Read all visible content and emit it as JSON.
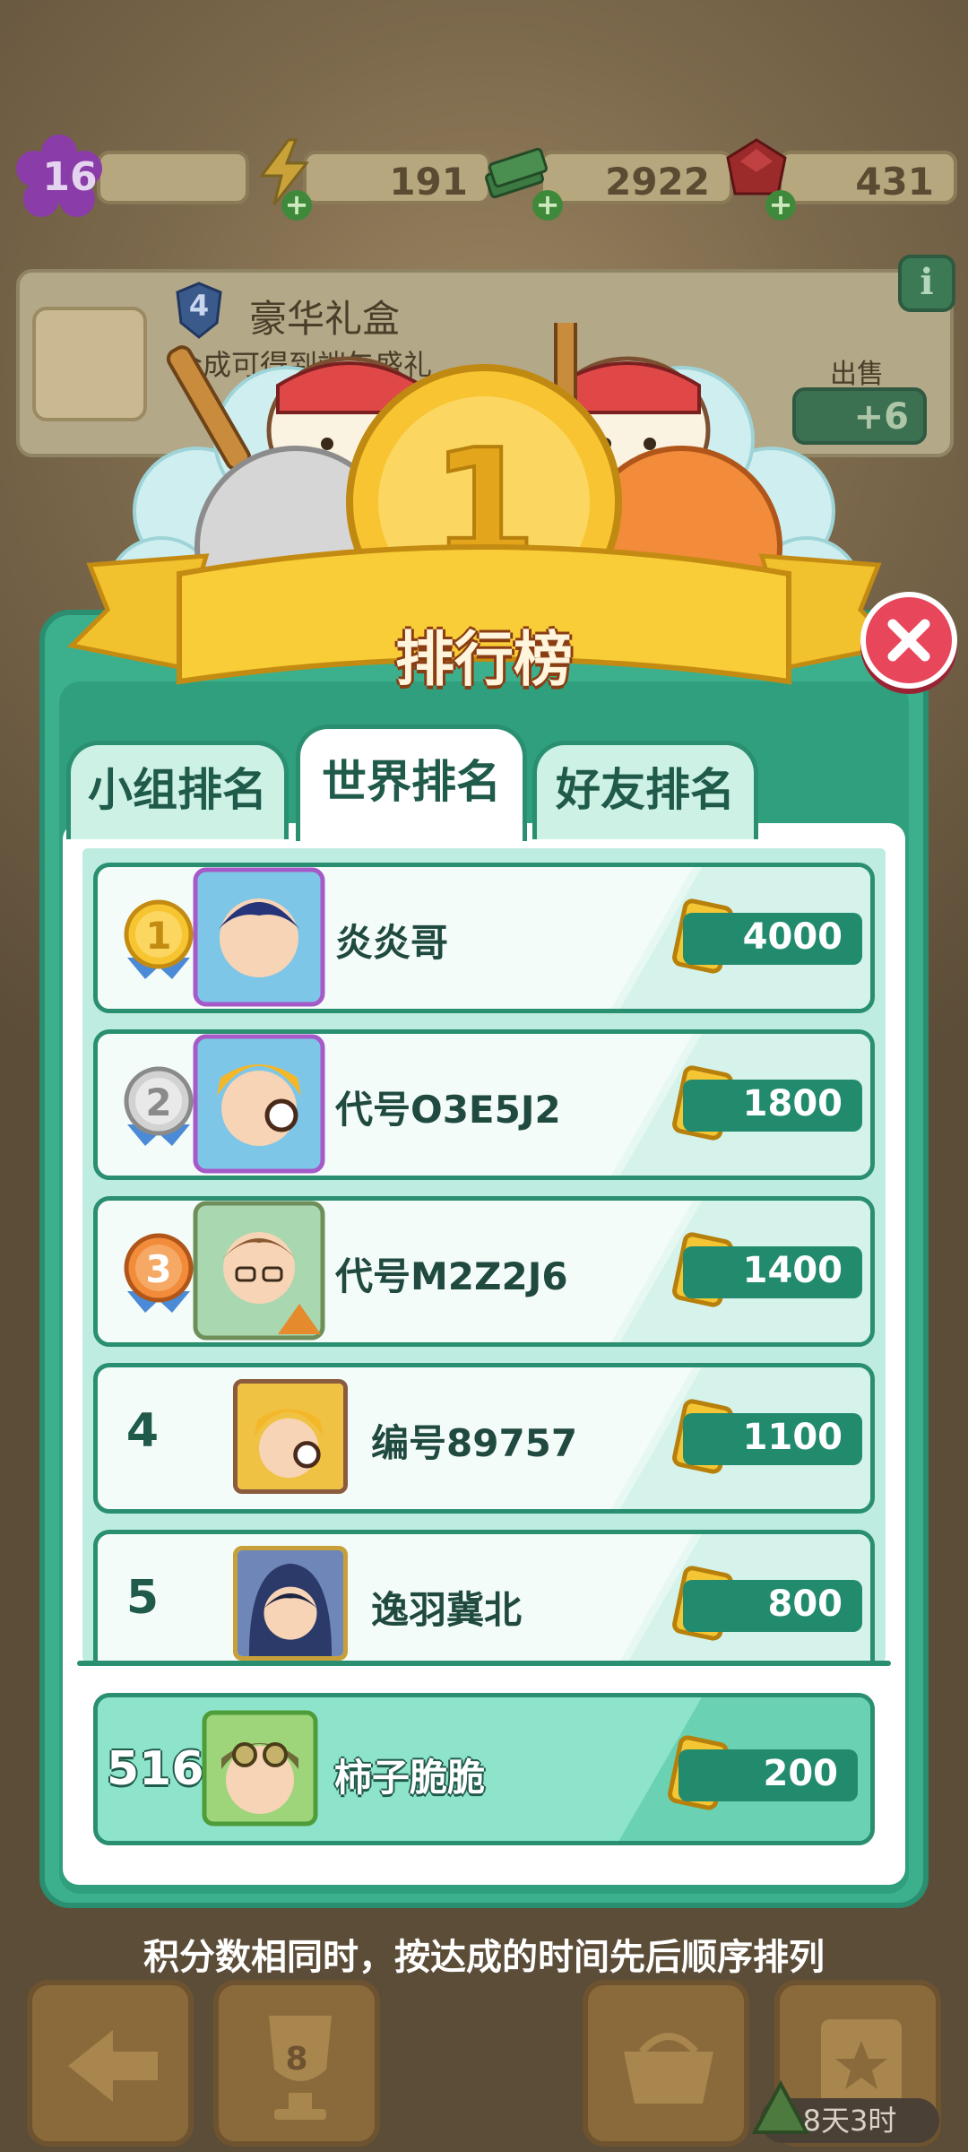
{
  "hud": {
    "level": "16",
    "energy": "191",
    "cash": "2922",
    "gems": "431"
  },
  "gift": {
    "level": "4",
    "title": "豪华礼盒",
    "subtitle": "合成可得到端午盛礼",
    "sell_label": "出售",
    "sell_value": "+6",
    "info": "i"
  },
  "leaderboard": {
    "title": "排行榜",
    "banner_number": "1",
    "tabs": [
      {
        "label": "小组排名",
        "active": false
      },
      {
        "label": "世界排名",
        "active": true
      },
      {
        "label": "好友排名",
        "active": false
      }
    ],
    "rows": [
      {
        "rank": "1",
        "name": "炎炎哥",
        "score": "4000"
      },
      {
        "rank": "2",
        "name": "代号O3E5J2",
        "score": "1800"
      },
      {
        "rank": "3",
        "name": "代号M2Z2J6",
        "score": "1400"
      },
      {
        "rank": "4",
        "name": "编号89757",
        "score": "1100"
      },
      {
        "rank": "5",
        "name": "逸羽冀北",
        "score": "800"
      }
    ],
    "me": {
      "rank": "516",
      "name": "柿子脆脆",
      "score": "200"
    },
    "footnote": "积分数相同时，按达成的时间先后顺序排列"
  },
  "bottom_nav": {
    "trophy_badge": "8",
    "timer": "8天3时"
  },
  "colors": {
    "accent_green": "#3cb08c",
    "dark_green": "#2a8f70",
    "score_pill": "#228b6e",
    "close_red": "#e8465a",
    "gold": "#f7c531"
  }
}
